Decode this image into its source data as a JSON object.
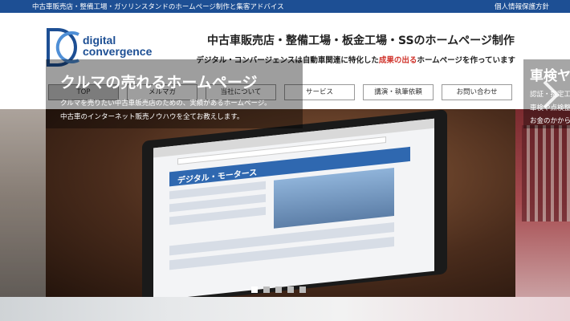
{
  "topbar": {
    "tagline": "中古車販売店・整備工場・ガソリンスタンドのホームページ制作と集客アドバイス",
    "privacy": "個人情報保護方針"
  },
  "header": {
    "logo_line1": "digital",
    "logo_line2": "convergence",
    "title": "中古車販売店・整備工場・板金工場・SSのホームページ制作",
    "subtitle_pre": "デジタル・コンバージェンスは自動車関連に特化した",
    "subtitle_accent": "成果の出る",
    "subtitle_post": "ホームページを作っています"
  },
  "nav": {
    "items": [
      {
        "label": "TOP",
        "active": true
      },
      {
        "label": "メルマガ"
      },
      {
        "label": "当社について"
      },
      {
        "label": "サービス"
      },
      {
        "label": "講演・執筆依頼"
      },
      {
        "label": "お問い合わせ"
      }
    ]
  },
  "slider": {
    "screen_brand": "デジタル・モータース",
    "caption_title": "クルマの売れるホームページ",
    "caption_line1": "クルマを売りたい中古車販売店のための、実績があるホームページ。",
    "caption_line2": "中古車のインターネット販売ノウハウを全てお教えします。",
    "next_title": "車検ヤ",
    "next_line1": "認証・指定工",
    "next_line2": "車検や点検整",
    "next_line3": "お金のかから",
    "dots_count": 5,
    "active_dot": 1
  },
  "colors": {
    "brand_blue": "#1d4f94",
    "accent_red": "#d0342c"
  }
}
